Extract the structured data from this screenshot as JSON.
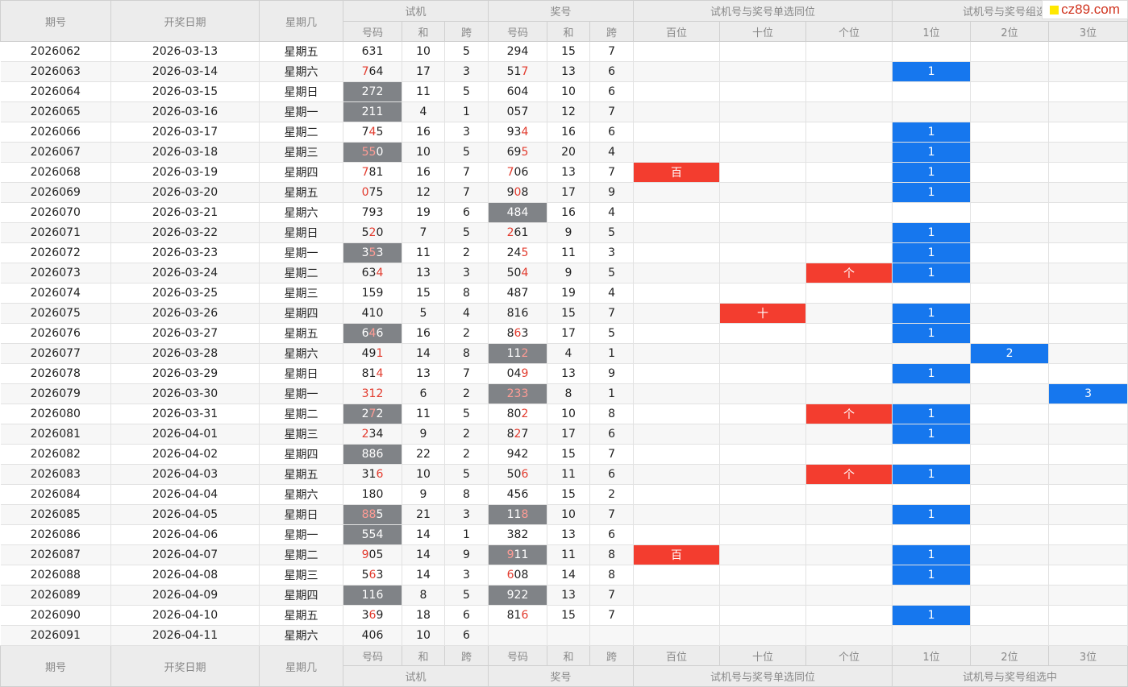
{
  "header": {
    "issue": "期号",
    "date": "开奖日期",
    "weekday": "星期几",
    "trial": "试机",
    "prize": "奖号",
    "same_pos": "试机号与奖号单选同位",
    "group": "试机号与奖号组选中",
    "sub_num": "号码",
    "sub_sum": "和",
    "sub_span": "跨",
    "hundreds": "百位",
    "tens": "十位",
    "units": "个位",
    "p1": "1位",
    "p2": "2位",
    "p3": "3位"
  },
  "logo": {
    "text": "cz89.com",
    "badge_color": "#ffe800"
  },
  "colors": {
    "red_fill": "#f33d2f",
    "blue_fill": "#1677ee",
    "gray_fill": "#808387",
    "red_digit": "#e23b2e"
  },
  "rows": [
    {
      "issue": "2026062",
      "date": "2026-03-13",
      "day": "星期五",
      "t": "631",
      "ts": "10",
      "tk": "5",
      "p": "294",
      "ps": "15",
      "pk": "7",
      "bai": "",
      "shi": "",
      "ge": "",
      "g1": "",
      "g2": "",
      "g3": ""
    },
    {
      "issue": "2026063",
      "date": "2026-03-14",
      "day": "星期六",
      "t": "764",
      "ts": "17",
      "tk": "3",
      "p": "517",
      "ps": "13",
      "pk": "6",
      "bai": "",
      "shi": "",
      "ge": "",
      "g1": "1",
      "g2": "",
      "g3": ""
    },
    {
      "issue": "2026064",
      "date": "2026-03-15",
      "day": "星期日",
      "t": "272",
      "ts": "11",
      "tk": "5",
      "p": "604",
      "ps": "10",
      "pk": "6",
      "bai": "",
      "shi": "",
      "ge": "",
      "g1": "",
      "g2": "",
      "g3": ""
    },
    {
      "issue": "2026065",
      "date": "2026-03-16",
      "day": "星期一",
      "t": "211",
      "ts": "4",
      "tk": "1",
      "p": "057",
      "ps": "12",
      "pk": "7",
      "bai": "",
      "shi": "",
      "ge": "",
      "g1": "",
      "g2": "",
      "g3": ""
    },
    {
      "issue": "2026066",
      "date": "2026-03-17",
      "day": "星期二",
      "t": "745",
      "ts": "16",
      "tk": "3",
      "p": "934",
      "ps": "16",
      "pk": "6",
      "bai": "",
      "shi": "",
      "ge": "",
      "g1": "1",
      "g2": "",
      "g3": ""
    },
    {
      "issue": "2026067",
      "date": "2026-03-18",
      "day": "星期三",
      "t": "550",
      "ts": "10",
      "tk": "5",
      "p": "695",
      "ps": "20",
      "pk": "4",
      "bai": "",
      "shi": "",
      "ge": "",
      "g1": "1",
      "g2": "",
      "g3": ""
    },
    {
      "issue": "2026068",
      "date": "2026-03-19",
      "day": "星期四",
      "t": "781",
      "ts": "16",
      "tk": "7",
      "p": "706",
      "ps": "13",
      "pk": "7",
      "bai": "百",
      "shi": "",
      "ge": "",
      "g1": "1",
      "g2": "",
      "g3": ""
    },
    {
      "issue": "2026069",
      "date": "2026-03-20",
      "day": "星期五",
      "t": "075",
      "ts": "12",
      "tk": "7",
      "p": "908",
      "ps": "17",
      "pk": "9",
      "bai": "",
      "shi": "",
      "ge": "",
      "g1": "1",
      "g2": "",
      "g3": ""
    },
    {
      "issue": "2026070",
      "date": "2026-03-21",
      "day": "星期六",
      "t": "793",
      "ts": "19",
      "tk": "6",
      "p": "484",
      "ps": "16",
      "pk": "4",
      "bai": "",
      "shi": "",
      "ge": "",
      "g1": "",
      "g2": "",
      "g3": ""
    },
    {
      "issue": "2026071",
      "date": "2026-03-22",
      "day": "星期日",
      "t": "520",
      "ts": "7",
      "tk": "5",
      "p": "261",
      "ps": "9",
      "pk": "5",
      "bai": "",
      "shi": "",
      "ge": "",
      "g1": "1",
      "g2": "",
      "g3": ""
    },
    {
      "issue": "2026072",
      "date": "2026-03-23",
      "day": "星期一",
      "t": "353",
      "ts": "11",
      "tk": "2",
      "p": "245",
      "ps": "11",
      "pk": "3",
      "bai": "",
      "shi": "",
      "ge": "",
      "g1": "1",
      "g2": "",
      "g3": ""
    },
    {
      "issue": "2026073",
      "date": "2026-03-24",
      "day": "星期二",
      "t": "634",
      "ts": "13",
      "tk": "3",
      "p": "504",
      "ps": "9",
      "pk": "5",
      "bai": "",
      "shi": "",
      "ge": "个",
      "g1": "1",
      "g2": "",
      "g3": ""
    },
    {
      "issue": "2026074",
      "date": "2026-03-25",
      "day": "星期三",
      "t": "159",
      "ts": "15",
      "tk": "8",
      "p": "487",
      "ps": "19",
      "pk": "4",
      "bai": "",
      "shi": "",
      "ge": "",
      "g1": "",
      "g2": "",
      "g3": ""
    },
    {
      "issue": "2026075",
      "date": "2026-03-26",
      "day": "星期四",
      "t": "410",
      "ts": "5",
      "tk": "4",
      "p": "816",
      "ps": "15",
      "pk": "7",
      "bai": "",
      "shi": "十",
      "ge": "",
      "g1": "1",
      "g2": "",
      "g3": ""
    },
    {
      "issue": "2026076",
      "date": "2026-03-27",
      "day": "星期五",
      "t": "646",
      "ts": "16",
      "tk": "2",
      "p": "863",
      "ps": "17",
      "pk": "5",
      "bai": "",
      "shi": "",
      "ge": "",
      "g1": "1",
      "g2": "",
      "g3": ""
    },
    {
      "issue": "2026077",
      "date": "2026-03-28",
      "day": "星期六",
      "t": "491",
      "ts": "14",
      "tk": "8",
      "p": "112",
      "ps": "4",
      "pk": "1",
      "bai": "",
      "shi": "",
      "ge": "",
      "g1": "",
      "g2": "2",
      "g3": ""
    },
    {
      "issue": "2026078",
      "date": "2026-03-29",
      "day": "星期日",
      "t": "814",
      "ts": "13",
      "tk": "7",
      "p": "049",
      "ps": "13",
      "pk": "9",
      "bai": "",
      "shi": "",
      "ge": "",
      "g1": "1",
      "g2": "",
      "g3": ""
    },
    {
      "issue": "2026079",
      "date": "2026-03-30",
      "day": "星期一",
      "t": "312",
      "ts": "6",
      "tk": "2",
      "p": "233",
      "ps": "8",
      "pk": "1",
      "bai": "",
      "shi": "",
      "ge": "",
      "g1": "",
      "g2": "",
      "g3": "3"
    },
    {
      "issue": "2026080",
      "date": "2026-03-31",
      "day": "星期二",
      "t": "272",
      "ts": "11",
      "tk": "5",
      "p": "802",
      "ps": "10",
      "pk": "8",
      "bai": "",
      "shi": "",
      "ge": "个",
      "g1": "1",
      "g2": "",
      "g3": ""
    },
    {
      "issue": "2026081",
      "date": "2026-04-01",
      "day": "星期三",
      "t": "234",
      "ts": "9",
      "tk": "2",
      "p": "827",
      "ps": "17",
      "pk": "6",
      "bai": "",
      "shi": "",
      "ge": "",
      "g1": "1",
      "g2": "",
      "g3": ""
    },
    {
      "issue": "2026082",
      "date": "2026-04-02",
      "day": "星期四",
      "t": "886",
      "ts": "22",
      "tk": "2",
      "p": "942",
      "ps": "15",
      "pk": "7",
      "bai": "",
      "shi": "",
      "ge": "",
      "g1": "",
      "g2": "",
      "g3": ""
    },
    {
      "issue": "2026083",
      "date": "2026-04-03",
      "day": "星期五",
      "t": "316",
      "ts": "10",
      "tk": "5",
      "p": "506",
      "ps": "11",
      "pk": "6",
      "bai": "",
      "shi": "",
      "ge": "个",
      "g1": "1",
      "g2": "",
      "g3": ""
    },
    {
      "issue": "2026084",
      "date": "2026-04-04",
      "day": "星期六",
      "t": "180",
      "ts": "9",
      "tk": "8",
      "p": "456",
      "ps": "15",
      "pk": "2",
      "bai": "",
      "shi": "",
      "ge": "",
      "g1": "",
      "g2": "",
      "g3": ""
    },
    {
      "issue": "2026085",
      "date": "2026-04-05",
      "day": "星期日",
      "t": "885",
      "ts": "21",
      "tk": "3",
      "p": "118",
      "ps": "10",
      "pk": "7",
      "bai": "",
      "shi": "",
      "ge": "",
      "g1": "1",
      "g2": "",
      "g3": ""
    },
    {
      "issue": "2026086",
      "date": "2026-04-06",
      "day": "星期一",
      "t": "554",
      "ts": "14",
      "tk": "1",
      "p": "382",
      "ps": "13",
      "pk": "6",
      "bai": "",
      "shi": "",
      "ge": "",
      "g1": "",
      "g2": "",
      "g3": ""
    },
    {
      "issue": "2026087",
      "date": "2026-04-07",
      "day": "星期二",
      "t": "905",
      "ts": "14",
      "tk": "9",
      "p": "911",
      "ps": "11",
      "pk": "8",
      "bai": "百",
      "shi": "",
      "ge": "",
      "g1": "1",
      "g2": "",
      "g3": ""
    },
    {
      "issue": "2026088",
      "date": "2026-04-08",
      "day": "星期三",
      "t": "563",
      "ts": "14",
      "tk": "3",
      "p": "608",
      "ps": "14",
      "pk": "8",
      "bai": "",
      "shi": "",
      "ge": "",
      "g1": "1",
      "g2": "",
      "g3": ""
    },
    {
      "issue": "2026089",
      "date": "2026-04-09",
      "day": "星期四",
      "t": "116",
      "ts": "8",
      "tk": "5",
      "p": "922",
      "ps": "13",
      "pk": "7",
      "bai": "",
      "shi": "",
      "ge": "",
      "g1": "",
      "g2": "",
      "g3": ""
    },
    {
      "issue": "2026090",
      "date": "2026-04-10",
      "day": "星期五",
      "t": "369",
      "ts": "18",
      "tk": "6",
      "p": "816",
      "ps": "15",
      "pk": "7",
      "bai": "",
      "shi": "",
      "ge": "",
      "g1": "1",
      "g2": "",
      "g3": ""
    },
    {
      "issue": "2026091",
      "date": "2026-04-11",
      "day": "星期六",
      "t": "406",
      "ts": "10",
      "tk": "6",
      "p": "",
      "ps": "",
      "pk": "",
      "bai": "",
      "shi": "",
      "ge": "",
      "g1": "",
      "g2": "",
      "g3": ""
    }
  ]
}
